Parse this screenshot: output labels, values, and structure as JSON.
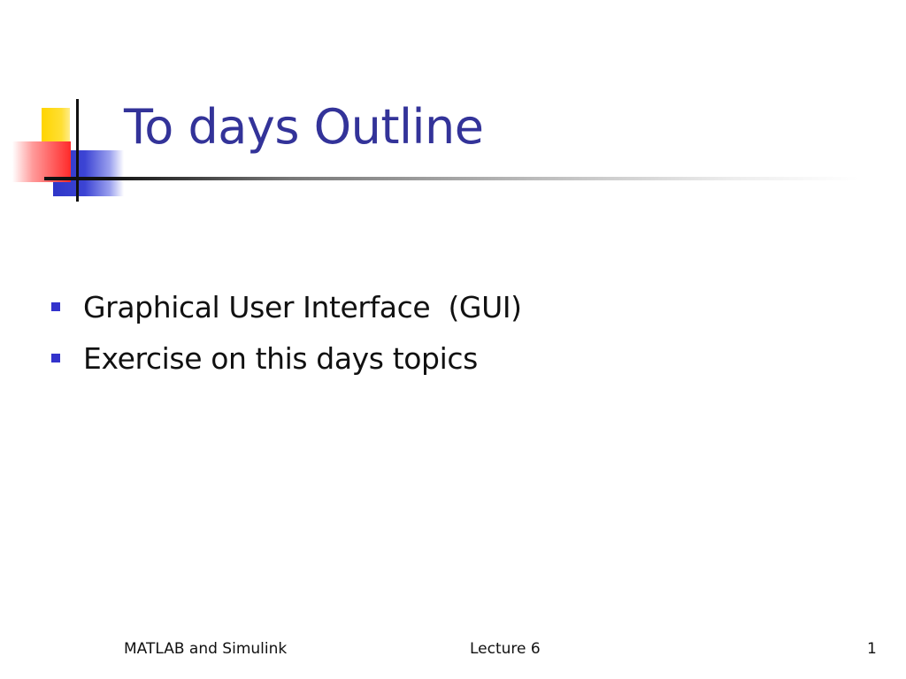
{
  "slide": {
    "title": "To days Outline",
    "bullets": [
      {
        "text": "Graphical User Interface  (GUI)"
      },
      {
        "text": "Exercise on this days topics"
      }
    ],
    "footer": {
      "left": "MATLAB and Simulink",
      "center": "Lecture 6",
      "page_number": "1"
    }
  },
  "colors": {
    "title": "#333399",
    "bullet_marker": "#3333CC",
    "deco_yellow": "#FFD400",
    "deco_blue": "#2E36C8",
    "deco_red": "#FF2A2A"
  }
}
